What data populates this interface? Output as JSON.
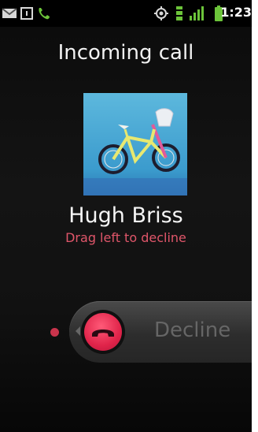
{
  "status_bar": {
    "time": "1:23",
    "icons": [
      "gmail-icon",
      "sim-card-icon",
      "phone-call-icon",
      "gps-icon",
      "data-icon",
      "signal-icon",
      "battery-icon"
    ]
  },
  "screen": {
    "title": "Incoming call",
    "caller": {
      "name": "Hugh Briss",
      "photo": "bicycle-photo"
    },
    "hint": "Drag left to decline",
    "slider": {
      "label": "Decline",
      "handle_icon": "phone-hangup-icon"
    }
  },
  "colors": {
    "background": "#000000",
    "hint": "#e0566a",
    "decline_handle": "#e0244a",
    "call_icon": "#6cc43a"
  }
}
